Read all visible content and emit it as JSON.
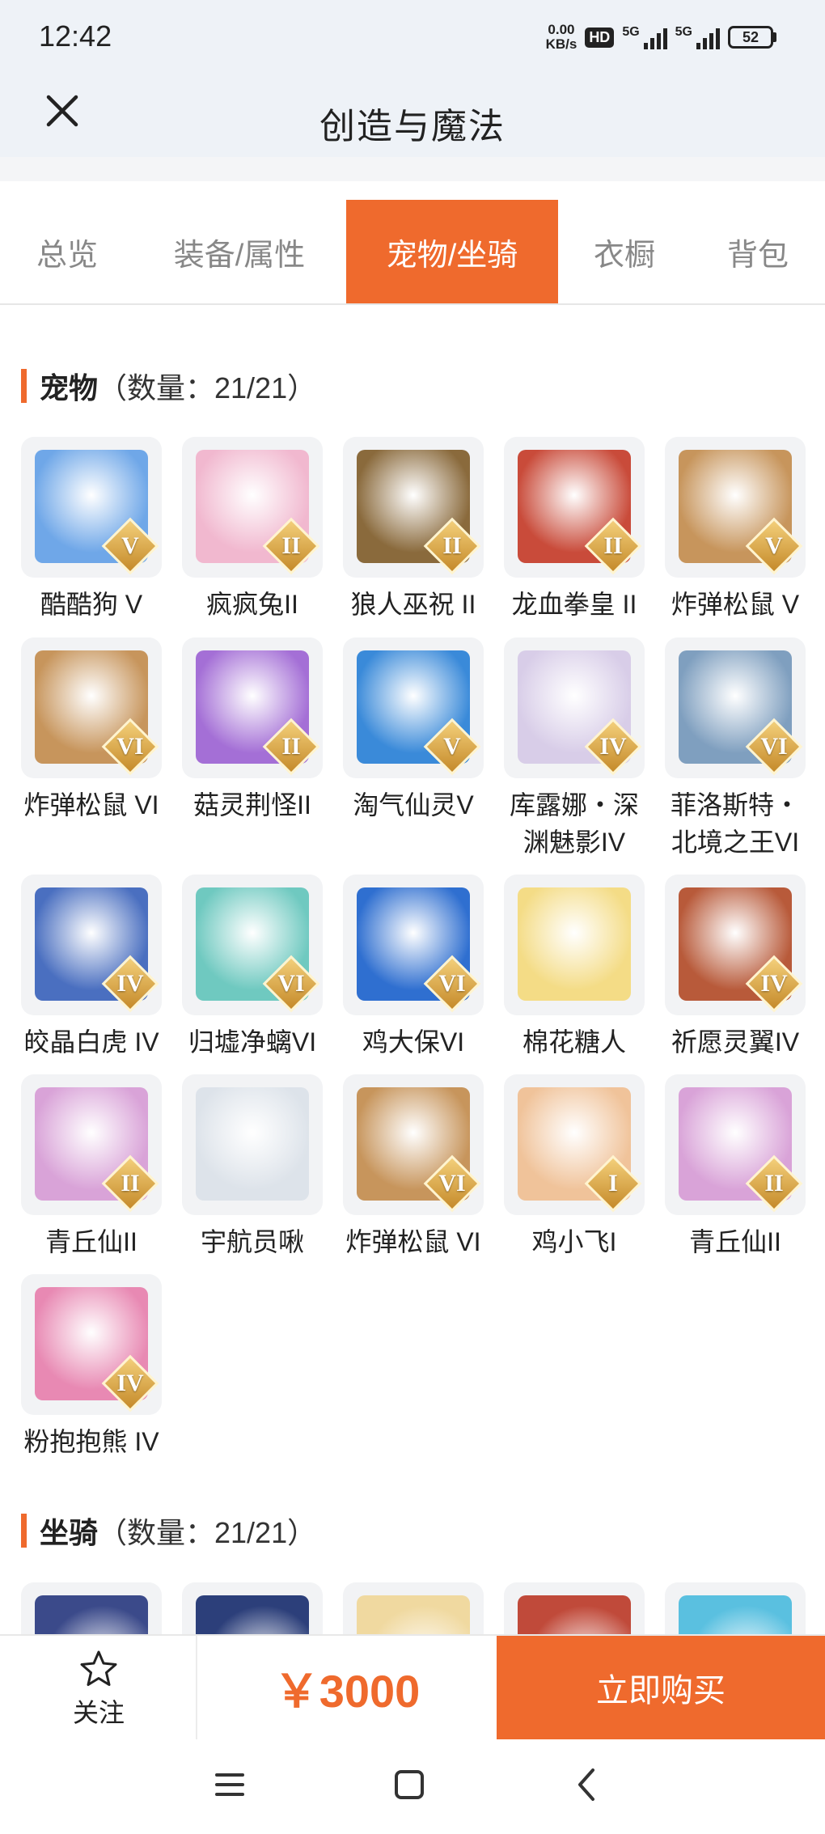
{
  "status_bar": {
    "time": "12:42",
    "net_speed_value": "0.00",
    "net_speed_unit": "KB/s",
    "hd_badge": "HD",
    "signal1": "5G",
    "signal2": "5G",
    "battery": "52"
  },
  "header": {
    "title": "创造与魔法",
    "close_icon": "close-icon"
  },
  "tabs": [
    {
      "label": "总览",
      "active": false
    },
    {
      "label": "装备/属性",
      "active": false
    },
    {
      "label": "宠物/坐骑",
      "active": true
    },
    {
      "label": "衣橱",
      "active": false
    },
    {
      "label": "背包",
      "active": false
    }
  ],
  "pets": {
    "title": "宠物",
    "count_text": "（数量：21/21）",
    "items": [
      {
        "name": "酷酷狗 V",
        "rank": "V",
        "color": "#6fa7e8"
      },
      {
        "name": "疯疯兔II",
        "rank": "II",
        "color": "#f1b8cf"
      },
      {
        "name": "狼人巫祝 II",
        "rank": "II",
        "color": "#8a6a3c"
      },
      {
        "name": "龙血拳皇 II",
        "rank": "II",
        "color": "#c94b3a"
      },
      {
        "name": "炸弹松鼠 V",
        "rank": "V",
        "color": "#c7955c"
      },
      {
        "name": "炸弹松鼠 VI",
        "rank": "VI",
        "color": "#c7955c"
      },
      {
        "name": "菇灵荆怪II",
        "rank": "II",
        "color": "#a46fd6"
      },
      {
        "name": "淘气仙灵V",
        "rank": "V",
        "color": "#3a8ad9"
      },
      {
        "name": "库露娜・深渊魅影IV",
        "rank": "IV",
        "color": "#d8cde8"
      },
      {
        "name": "菲洛斯特・北境之王VI",
        "rank": "VI",
        "color": "#7f9fbf"
      },
      {
        "name": "皎晶白虎 IV",
        "rank": "IV",
        "color": "#4a6fc0"
      },
      {
        "name": "归墟净螭VI",
        "rank": "VI",
        "color": "#6fc9c0"
      },
      {
        "name": "鸡大保VI",
        "rank": "VI",
        "color": "#2f6fd0"
      },
      {
        "name": "棉花糖人",
        "rank": "",
        "color": "#f4dc86"
      },
      {
        "name": "祈愿灵翼IV",
        "rank": "IV",
        "color": "#b85a3a"
      },
      {
        "name": "青丘仙II",
        "rank": "II",
        "color": "#d9a3d8"
      },
      {
        "name": "宇航员啾",
        "rank": "",
        "color": "#dde3ea"
      },
      {
        "name": "炸弹松鼠 VI",
        "rank": "VI",
        "color": "#c7955c"
      },
      {
        "name": "鸡小飞I",
        "rank": "I",
        "color": "#f0c39a"
      },
      {
        "name": "青丘仙II",
        "rank": "II",
        "color": "#d9a3d8"
      },
      {
        "name": "粉抱抱熊 IV",
        "rank": "IV",
        "color": "#e889b3"
      }
    ]
  },
  "mounts": {
    "title": "坐骑",
    "count_text": "（数量：21/21）",
    "preview_colors": [
      "#3b4a8a",
      "#2c3f7a",
      "#f0d9a0",
      "#c04a3a",
      "#5ac0e0"
    ]
  },
  "bottom_bar": {
    "follow_label": "关注",
    "price": "￥3000",
    "buy_label": "立即购买"
  },
  "colors": {
    "accent": "#ef6a2d"
  }
}
